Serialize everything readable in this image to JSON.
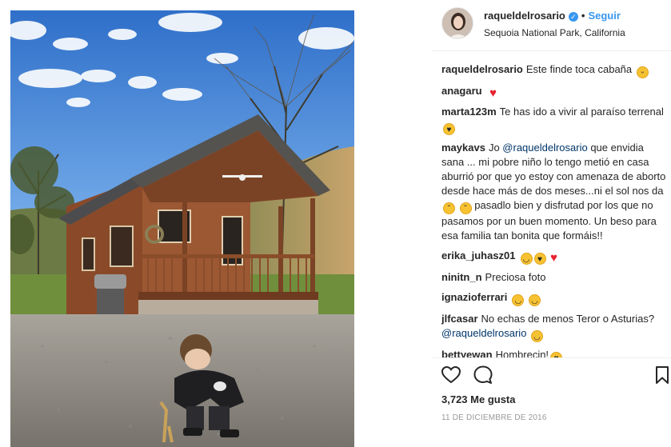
{
  "post": {
    "username": "raqueldelrosario",
    "follow_label": "Seguir",
    "location": "Sequoia National Park, California",
    "likes": "3,723 Me gusta",
    "date": "11 DE DICIEMBRE DE 2016"
  },
  "comments": [
    {
      "user": "raqueldelrosario",
      "text": "Este finde toca cabaña",
      "emojis": [
        "grin-face"
      ]
    },
    {
      "user": "anagaru",
      "text": "",
      "emojis": [
        "red-heart"
      ]
    },
    {
      "user": "marta123m",
      "text": "Te has ido a vivir al paraíso terrenal",
      "emojis": [
        "heart-eyes-face"
      ]
    },
    {
      "user": "maykavs",
      "parts": [
        "Jo ",
        "@raqueldelrosario",
        " que envidia sana ... mi pobre niño lo tengo metió en casa aburrió por que yo estoy con amenaza de aborto desde hace más de dos meses...ni el sol nos da ",
        " pasadlo bien y disfrutad por los que no pasamos por un buen momento. Un beso para esa familia tan bonita que formáis!!"
      ]
    },
    {
      "user": "erika_juhasz01",
      "text": "",
      "emojis": [
        "smile-face",
        "kiss-face",
        "red-heart"
      ]
    },
    {
      "user": "ninitn_n",
      "text": "Preciosa foto",
      "emojis": []
    },
    {
      "user": "ignaziofеrrari",
      "text": "",
      "emojis": [
        "hug-face",
        "hug-face"
      ]
    },
    {
      "user": "jlfcasar",
      "parts": [
        "No echas de menos Teror o Asturias? ",
        "@raqueldelrosario",
        " "
      ]
    },
    {
      "user": "bettyewan",
      "text": "Hombrecin!",
      "emojis": [
        "heart-eyes-face"
      ]
    }
  ],
  "icons": {
    "verified": "verified-badge-icon",
    "like": "heart-outline-icon",
    "comment": "speech-bubble-icon",
    "save": "bookmark-icon"
  },
  "colors": {
    "link_blue": "#3897f0",
    "mention": "#003569",
    "text": "#262626",
    "muted": "#999999"
  }
}
